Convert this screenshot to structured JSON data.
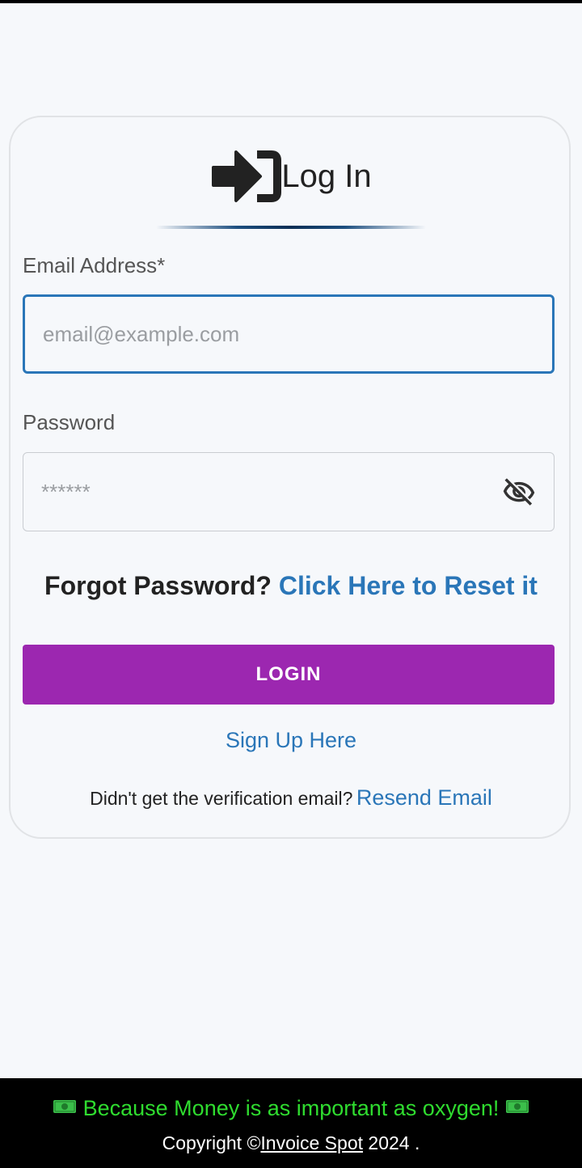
{
  "header": {
    "title": "Log In",
    "icon": "login-icon"
  },
  "form": {
    "email": {
      "label": "Email Address*",
      "placeholder": "email@example.com",
      "value": ""
    },
    "password": {
      "label": "Password",
      "placeholder": "******",
      "value": "",
      "toggle_icon": "eye-off-icon"
    },
    "forgot": {
      "text": "Forgot Password?",
      "link": "Click Here to Reset it"
    },
    "login_button": "LOGIN",
    "signup_link": "Sign Up Here",
    "resend": {
      "text": "Didn't get the verification email?",
      "link": "Resend Email"
    }
  },
  "footer": {
    "tagline": "Because Money is as important as oxygen!",
    "tagline_icon": "money-icon",
    "copyright_prefix": "Copyright ©",
    "brand": "Invoice Spot",
    "year_suffix": "2024 ."
  },
  "colors": {
    "accent_blue": "#2a76b8",
    "button_purple": "#9c27b0",
    "tagline_green": "#2fdc2f",
    "background": "#f6f8fb"
  }
}
